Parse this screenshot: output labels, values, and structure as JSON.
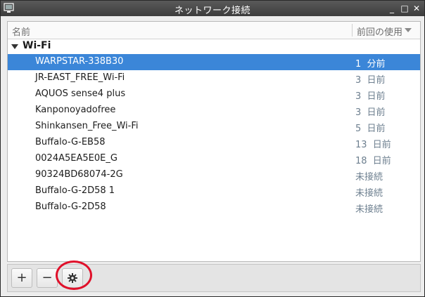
{
  "window": {
    "title": "ネットワーク接続",
    "controls": {
      "minimize": "_",
      "maximize": "□",
      "close": "✕"
    }
  },
  "columns": {
    "name": "名前",
    "last_used": "前回の使用"
  },
  "group": {
    "label": "Wi-Fi"
  },
  "connections": [
    {
      "name": "WARPSTAR-338B30",
      "last_used": "1  分前",
      "selected": true
    },
    {
      "name": "JR-EAST_FREE_Wi-Fi",
      "last_used": "3  日前"
    },
    {
      "name": "AQUOS sense4 plus",
      "last_used": "3  日前"
    },
    {
      "name": "Kanponoyadofree",
      "last_used": "3  日前"
    },
    {
      "name": "Shinkansen_Free_Wi-Fi",
      "last_used": "5  日前"
    },
    {
      "name": "Buffalo-G-EB58",
      "last_used": "13  日前"
    },
    {
      "name": "0024A5EA5E0E_G",
      "last_used": "18  日前"
    },
    {
      "name": "90324BD68074-2G",
      "last_used": "未接続"
    },
    {
      "name": "Buffalo-G-2D58 1",
      "last_used": "未接続"
    },
    {
      "name": "Buffalo-G-2D58",
      "last_used": "未接続"
    }
  ],
  "toolbar": {
    "add": "+",
    "remove": "−",
    "settings_icon": "gear-icon"
  },
  "colors": {
    "selection": "#3b86d8",
    "annotation": "#e0102a"
  }
}
